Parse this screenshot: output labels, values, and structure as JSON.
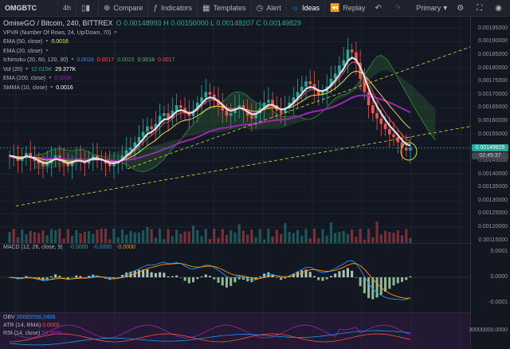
{
  "toolbar": {
    "symbol": "OMGBTC",
    "interval": "4h",
    "compare": "Compare",
    "indicators": "Indicators",
    "templates": "Templates",
    "alert": "Alert",
    "ideas": "Ideas",
    "replay": "Replay",
    "theme": "Primary",
    "icons": {
      "candles": "candles-icon",
      "compare": "compare-icon",
      "indicators": "fx-icon",
      "templates": "templates-icon",
      "alert": "alarm-icon",
      "ideas": "lightbulb-icon",
      "replay": "replay-icon",
      "undo": "undo-icon",
      "redo": "redo-icon",
      "settings": "gear-icon",
      "camera": "camera-icon",
      "fullscreen": "fullscreen-icon"
    }
  },
  "main_pane": {
    "title": "OmiseGO / Bitcoin, 240, BITTREX",
    "ohlc": "O 0.00148993 H 0.00150000 L 0.00148207 C 0.00149829",
    "indicators": [
      {
        "name": "VPVR (Number Of Rows, 24, Up/Down, 70)",
        "values": [],
        "colors": []
      },
      {
        "name": "EMA (50, close)",
        "values": [
          "0.0016"
        ],
        "colors": [
          "#ffeb3b"
        ]
      },
      {
        "name": "EMA (20, close)",
        "values": [],
        "colors": []
      },
      {
        "name": "Ichimoku (20, 60, 120, 30)",
        "values": [
          "0.0016",
          "0.0017",
          "0.0015",
          "0.0018",
          "0.0017"
        ],
        "colors": [
          "#2196f3",
          "#ef5350",
          "#4caf50",
          "#66bb6a",
          "#ef5350"
        ]
      },
      {
        "name": "Vol (20)",
        "values": [
          "12.015K",
          "29.377K"
        ],
        "colors": [
          "#26a69a",
          "#ffffff"
        ]
      },
      {
        "name": "EMA (200, close)",
        "values": [
          "0.0016"
        ],
        "colors": [
          "#9c27b0"
        ]
      },
      {
        "name": "SMMA (10, close)",
        "values": [
          "0.0016"
        ],
        "colors": [
          "#ffffff"
        ]
      }
    ]
  },
  "price_axis": {
    "labels": [
      "0.00195000",
      "0.00190000",
      "0.00185000",
      "0.00180000",
      "0.00175000",
      "0.00170000",
      "0.00165000",
      "0.00160000",
      "0.00155000",
      "0.00150000",
      "0.00145000",
      "0.00140000",
      "0.00135000",
      "0.00130000",
      "0.00125000",
      "0.00120000",
      "0.00115000"
    ],
    "current_price": "0.00149829",
    "countdown": "02:45:37",
    "current_color": "#26a69a"
  },
  "macd_pane": {
    "label": "MACD (12, 26, close, 9)",
    "values": [
      "-0.0000",
      "-0.0000",
      "-0.0000"
    ],
    "colors": [
      "#26a69a",
      "#2196f3",
      "#ff9800"
    ],
    "axis": [
      "0.0001",
      "0.0000",
      "-0.0001"
    ]
  },
  "lower_pane": {
    "indicators": [
      {
        "name": "OBV",
        "value": "30065558.2406",
        "color": "#2196f3"
      },
      {
        "name": "ATR (14, RMA)",
        "value": "0.0000",
        "color": "#ef5350"
      },
      {
        "name": "RSI (14, close)",
        "value": "54.3990",
        "color": "#9c27b0"
      }
    ],
    "axis": [
      "30000000.0000"
    ]
  },
  "chart_data": {
    "type": "candlestick",
    "symbol": "OMGBTC",
    "exchange": "BITTREX",
    "interval": "240",
    "ylim": [
      0.00114,
      0.00197
    ],
    "closes": [
      0.00147,
      0.00146,
      0.00145,
      0.00146,
      0.00148,
      0.00146,
      0.00145,
      0.00144,
      0.00143,
      0.00144,
      0.00146,
      0.00147,
      0.00145,
      0.00144,
      0.00143,
      0.00145,
      0.00146,
      0.00145,
      0.00144,
      0.00146,
      0.00147,
      0.00146,
      0.00145,
      0.00144,
      0.00143,
      0.00144,
      0.00145,
      0.00147,
      0.00149,
      0.0015,
      0.00152,
      0.00154,
      0.00156,
      0.00158,
      0.00157,
      0.00159,
      0.00162,
      0.00163,
      0.00161,
      0.00164,
      0.00166,
      0.00165,
      0.00163,
      0.00162,
      0.00164,
      0.00167,
      0.00169,
      0.00171,
      0.0017,
      0.00168,
      0.00166,
      0.00164,
      0.00162,
      0.00163,
      0.00165,
      0.00166,
      0.00164,
      0.00162,
      0.00161,
      0.00163,
      0.00165,
      0.00167,
      0.00168,
      0.00166,
      0.00164,
      0.00163,
      0.00165,
      0.00167,
      0.00169,
      0.00171,
      0.00173,
      0.00175,
      0.00174,
      0.00172,
      0.0017,
      0.00171,
      0.00173,
      0.00176,
      0.00178,
      0.00181,
      0.00183,
      0.00187,
      0.00186,
      0.00182,
      0.00176,
      0.00171,
      0.00166,
      0.00163,
      0.00161,
      0.00159,
      0.00157,
      0.00155,
      0.00154,
      0.00152,
      0.0015,
      0.00149,
      0.0015
    ]
  }
}
